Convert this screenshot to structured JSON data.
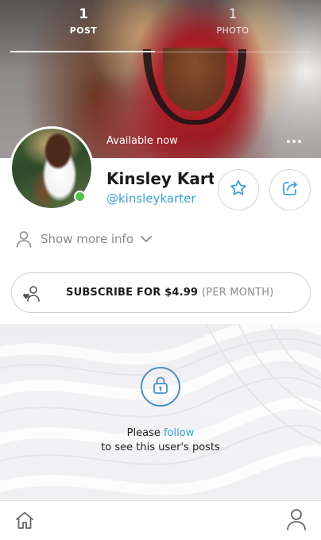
{
  "cover": {
    "tabs": [
      {
        "count": "1",
        "label": "POST",
        "active": true
      },
      {
        "count": "1",
        "label": "PHOTO",
        "active": false
      }
    ],
    "status": "Available now"
  },
  "profile": {
    "name": "Kinsley Kart...",
    "handle": "@kinsleykarter",
    "online": true
  },
  "more_info": {
    "label": "Show more info",
    "icons": [
      "user-outline-icon",
      "chevron-down-icon"
    ]
  },
  "subscribe": {
    "label": "SUBSCRIBE FOR $4.99",
    "period": "(PER MONTH)",
    "icon": "user-heart-icon"
  },
  "locked": {
    "icon": "lock-icon",
    "message_before": "Please ",
    "message_link": "follow",
    "message_after": "to see this user's posts"
  },
  "bottom_nav": {
    "icons": [
      "home-icon",
      "profile-icon"
    ]
  },
  "colors": {
    "accent": "#3ba3d6",
    "online": "#54c152",
    "lock": "#4a8fbf",
    "muted": "#8a8a8a"
  }
}
